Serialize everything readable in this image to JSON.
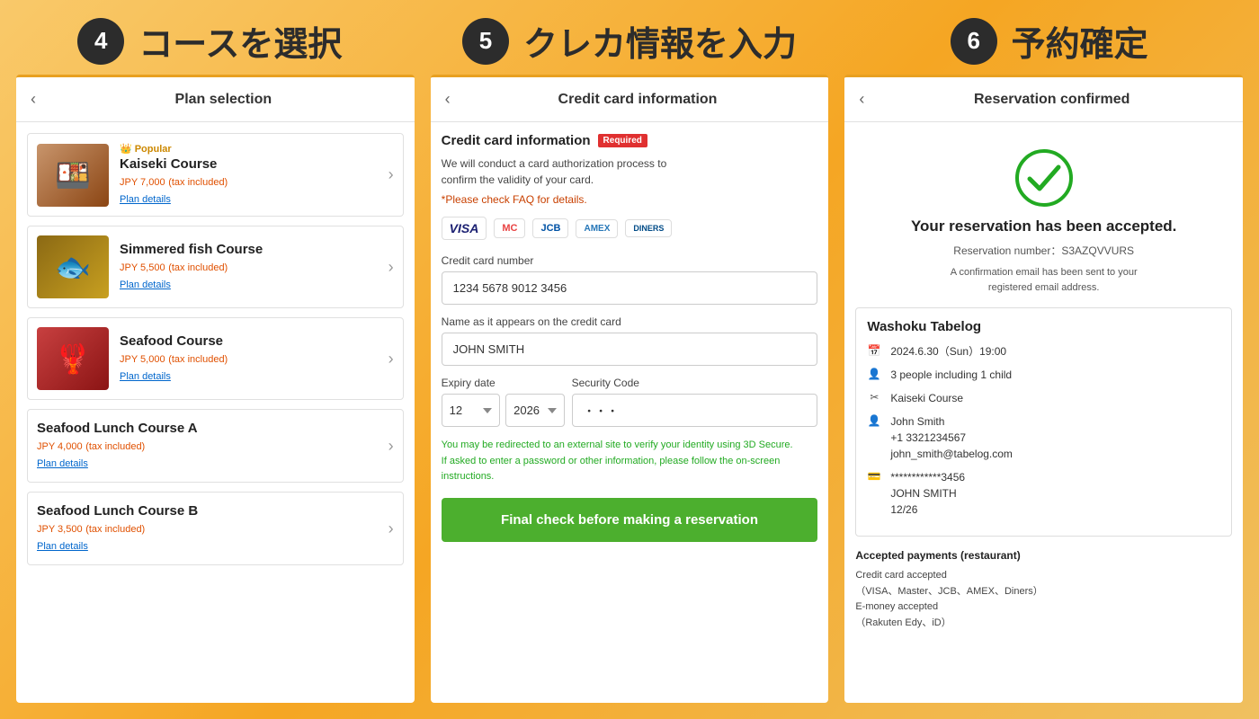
{
  "background": "#f5a623",
  "steps": [
    {
      "number": "4",
      "title": "コースを選択",
      "panel_title": "Plan selection"
    },
    {
      "number": "5",
      "title": "クレカ情報を入力",
      "panel_title": "Credit card information"
    },
    {
      "number": "6",
      "title": "予約確定",
      "panel_title": "Reservation confirmed"
    }
  ],
  "panel1": {
    "back_arrow": "‹",
    "title": "Plan selection",
    "plans": [
      {
        "id": "kaiseki",
        "popular": true,
        "popular_label": "Popular",
        "name": "Kaiseki Course",
        "price": "JPY 7,000",
        "price_note": "(tax included)",
        "details_link": "Plan details",
        "has_image": true,
        "image_class": "img-kaiseki",
        "emoji": "🍱"
      },
      {
        "id": "simmered",
        "popular": false,
        "name": "Simmered fish Course",
        "price": "JPY 5,500",
        "price_note": "(tax included)",
        "details_link": "Plan details",
        "has_image": true,
        "image_class": "img-simmered",
        "emoji": "🐟"
      },
      {
        "id": "seafood",
        "popular": false,
        "name": "Seafood Course",
        "price": "JPY 5,000",
        "price_note": "(tax included)",
        "details_link": "Plan details",
        "has_image": true,
        "image_class": "img-seafood",
        "emoji": "🦞"
      },
      {
        "id": "seafood-lunch-a",
        "popular": false,
        "name": "Seafood Lunch Course A",
        "price": "JPY 4,000",
        "price_note": "(tax included)",
        "details_link": "Plan details",
        "has_image": false
      },
      {
        "id": "seafood-lunch-b",
        "popular": false,
        "name": "Seafood Lunch Course B",
        "price": "JPY 3,500",
        "price_note": "(tax included)",
        "details_link": "Plan details",
        "has_image": false
      }
    ]
  },
  "panel2": {
    "back_arrow": "‹",
    "title": "Credit card information",
    "section_title": "Credit card information",
    "required_badge": "Required",
    "description": "We will conduct a card authorization process to\nconfirm the validity of your card.",
    "faq_link": "*Please check FAQ for details.",
    "card_logos": [
      "VISA",
      "MC",
      "JCB",
      "AMEX",
      "DINERS"
    ],
    "cc_number_label": "Credit card number",
    "cc_number_value": "1234 5678 9012 3456",
    "cc_name_label": "Name as it appears on the credit card",
    "cc_name_value": "JOHN SMITH",
    "expiry_label": "Expiry date",
    "security_label": "Security Code",
    "expiry_month": "12",
    "expiry_year": "2026",
    "security_code": "・・・",
    "warning_text": "You may be redirected to an external site to verify your\nidentity using 3D Secure.\nIf asked to enter a password or other information, please\nfollow the on-screen instructions.",
    "btn_label": "Final check before making a reservation"
  },
  "panel3": {
    "back_arrow": "‹",
    "title": "Reservation confirmed",
    "check_icon": "✓",
    "confirmed_title": "Your reservation has been accepted.",
    "res_number_label": "Reservation number：",
    "res_number": "S3AZQVVURS",
    "email_note": "A confirmation email has been sent to your\nregistered email address.",
    "restaurant": "Washoku Tabelog",
    "date": "2024.6.30（Sun）19:00",
    "guests": "3 people including 1 child",
    "course": "Kaiseki Course",
    "name": "John Smith",
    "phone": "+1 3321234567",
    "email": "john_smith@tabelog.com",
    "card_masked": "************3456",
    "card_name": "JOHN SMITH",
    "card_expiry": "12/26",
    "payments_title": "Accepted payments (restaurant)",
    "card_accepted_label": "Credit card accepted",
    "card_accepted_brands": "（VISA、Master、JCB、AMEX、Diners）",
    "emoney_label": "E-money accepted",
    "emoney_brands": "（Rakuten Edy、iD）"
  }
}
